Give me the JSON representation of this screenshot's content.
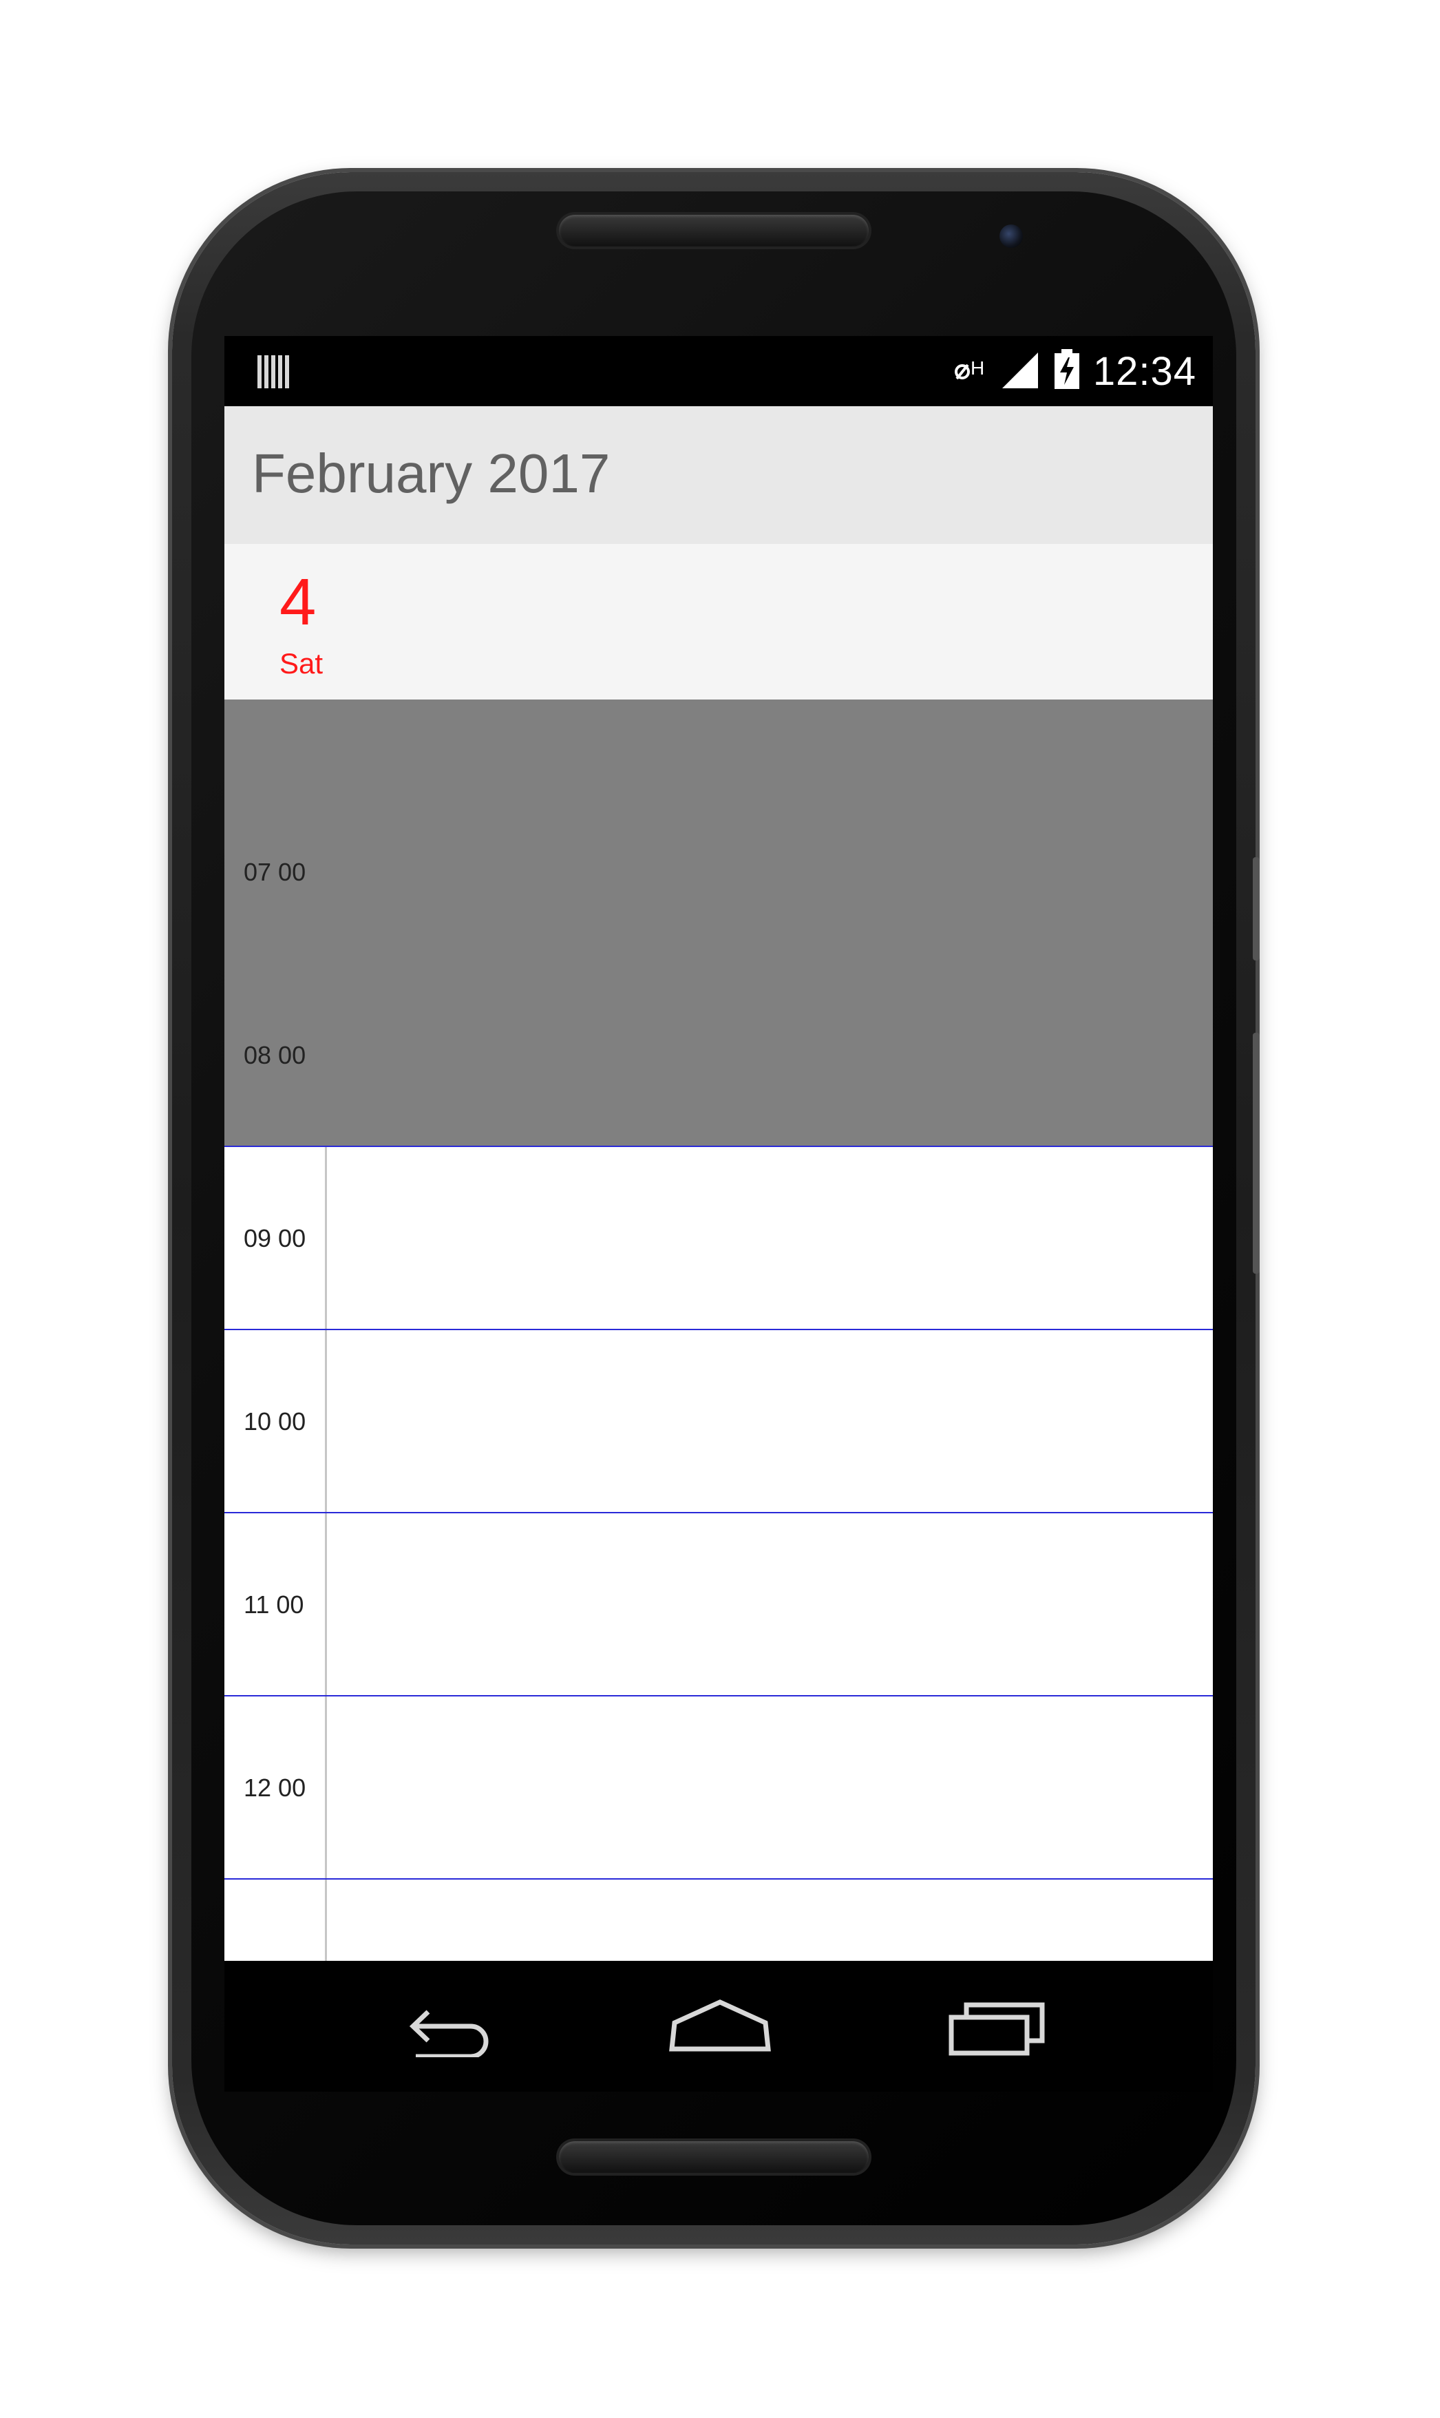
{
  "status_bar": {
    "time": "12:34",
    "left_icon": "storage-notification-icon",
    "icons": [
      "data-roaming-icon",
      "signal-icon",
      "battery-charging-icon"
    ]
  },
  "app_bar": {
    "title": "February 2017"
  },
  "day_header": {
    "day_number": "4",
    "day_name": "Sat",
    "accent_color": "#ff1a1a"
  },
  "timeline": {
    "hours": [
      {
        "label": "07 00"
      },
      {
        "label": "08 00"
      },
      {
        "label": "09 00"
      },
      {
        "label": "10 00"
      },
      {
        "label": "11 00"
      },
      {
        "label": "12 00"
      }
    ],
    "non_working_color": "#808080",
    "hour_line_color": "#2a2ad8"
  },
  "nav_bar": {
    "buttons": [
      "back-icon",
      "home-icon",
      "recents-icon"
    ]
  }
}
